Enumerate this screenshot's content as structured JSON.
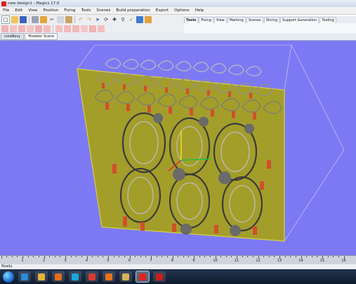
{
  "window": {
    "title": "new design1 - Magics 17.0"
  },
  "menu": [
    "File",
    "Edit",
    "View",
    "Position",
    "Fixing",
    "Tools",
    "Scenes",
    "Build preparation",
    "Export",
    "Options",
    "Help"
  ],
  "toolbar_icons": [
    "new-icon",
    "open-icon",
    "save-icon",
    "print-icon",
    "import-icon",
    "cut-icon",
    "copy-icon",
    "paste-icon",
    "undo-icon",
    "redo-icon",
    "select-icon",
    "rotate-icon",
    "move-icon",
    "zoom-icon",
    "measure-icon",
    "check-icon",
    "view-icon"
  ],
  "toolbar2_icons": [
    "transform-icon",
    "mirror-icon",
    "duplicate-icon",
    "scale-icon",
    "cut-part-icon",
    "hollow-icon",
    "offset-icon",
    "boolean-icon",
    "label-icon",
    "merge-icon",
    "split-icon",
    "shell-icon"
  ],
  "ribbon_tabs": [
    {
      "label": "Tools",
      "active": true
    },
    {
      "label": "Fixing",
      "active": false
    },
    {
      "label": "View",
      "active": false
    },
    {
      "label": "Marking",
      "active": false
    },
    {
      "label": "Scenes",
      "active": false
    },
    {
      "label": "Slicing",
      "active": false
    },
    {
      "label": "Support Generation",
      "active": false
    },
    {
      "label": "Tooling",
      "active": false
    }
  ],
  "doc_tabs": [
    {
      "label": "coreBevy",
      "active": false
    },
    {
      "label": "Modeler Scene",
      "active": true
    }
  ],
  "ruler": {
    "labels": [
      "1",
      "2",
      "3",
      "4",
      "5",
      "6",
      "7",
      "8",
      "9",
      "10",
      "11",
      "12",
      "13",
      "14",
      "15",
      "16"
    ]
  },
  "status": {
    "text": "Ready"
  },
  "taskbar_items": [
    {
      "name": "ie-icon",
      "color": "#2d8ad8"
    },
    {
      "name": "explorer-icon",
      "color": "#e6b43a"
    },
    {
      "name": "media-player-icon",
      "color": "#e46b1c"
    },
    {
      "name": "skype-icon",
      "color": "#1ba6e0"
    },
    {
      "name": "chrome-icon",
      "color": "#d6392e"
    },
    {
      "name": "firefox-icon",
      "color": "#e8721c"
    },
    {
      "name": "explorer2-icon",
      "color": "#d8b25a"
    },
    {
      "name": "magics-icon",
      "color": "#d22"
    },
    {
      "name": "pdf-icon",
      "color": "#c81e1e"
    }
  ],
  "colors": {
    "viewport_bg": "#7d79f4",
    "platform": "#a39e2a",
    "platform_edge": "#d8d040"
  }
}
